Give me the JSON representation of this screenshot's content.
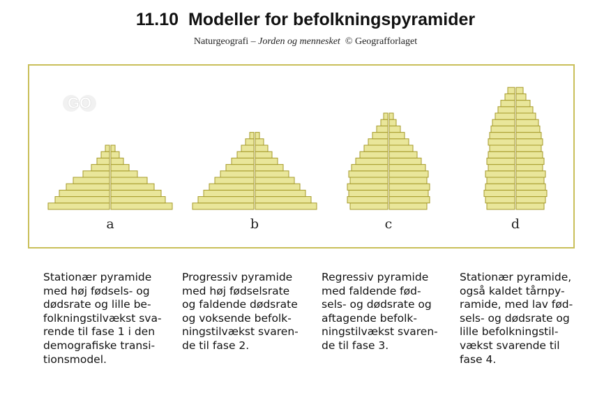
{
  "header": {
    "number": "11.10",
    "title": "Modeller for befolkningspyramider",
    "source_pre": "Naturgeografi –",
    "source_italic": "Jorden og mennesket",
    "source_post": "© Geografforlaget"
  },
  "logo": {
    "text": "GO"
  },
  "pyramids": [
    {
      "label": "a",
      "lines": [
        "Stationær pyramide",
        "med høj fødsels- og",
        "dødsrate og lille be-",
        "folkningstilvækst sva-",
        "rende til fase 1 i den",
        "demografiske transi-",
        "tionsmodel."
      ],
      "widths": [
        88,
        78,
        72,
        62,
        52,
        38,
        26,
        18,
        12,
        6
      ]
    },
    {
      "label": "b",
      "lines": [
        "Progressiv pyramide",
        "med høj fødselsrate",
        "og faldende dødsrate",
        "og voksende befolk-",
        "ningstilvækst svaren-",
        "de til fase 2."
      ],
      "widths": [
        88,
        80,
        72,
        64,
        56,
        48,
        40,
        32,
        24,
        18,
        12,
        6
      ]
    },
    {
      "label": "c",
      "lines": [
        "Regressiv pyramide",
        "med faldende fød-",
        "sels- og dødsrate og",
        "aftagende befolk-",
        "ningstilvækst svaren-",
        "de til fase 3."
      ],
      "widths": [
        54,
        58,
        56,
        58,
        54,
        56,
        52,
        46,
        40,
        34,
        28,
        22,
        16,
        10,
        6
      ]
    },
    {
      "label": "d",
      "lines": [
        "Stationær pyramide,",
        "også kaldet tårnpy-",
        "ramide, med lav fød-",
        "sels- og dødsrate og",
        "lille befolkningstil-",
        "vækst svarende til",
        "fase 4."
      ],
      "widths": [
        40,
        42,
        44,
        42,
        40,
        42,
        38,
        40,
        38,
        36,
        38,
        36,
        34,
        32,
        28,
        24,
        20,
        14,
        10
      ]
    }
  ],
  "colors": {
    "fill": "#e9e69a",
    "stroke": "#a59a2a",
    "frame": "#c9bf59"
  }
}
